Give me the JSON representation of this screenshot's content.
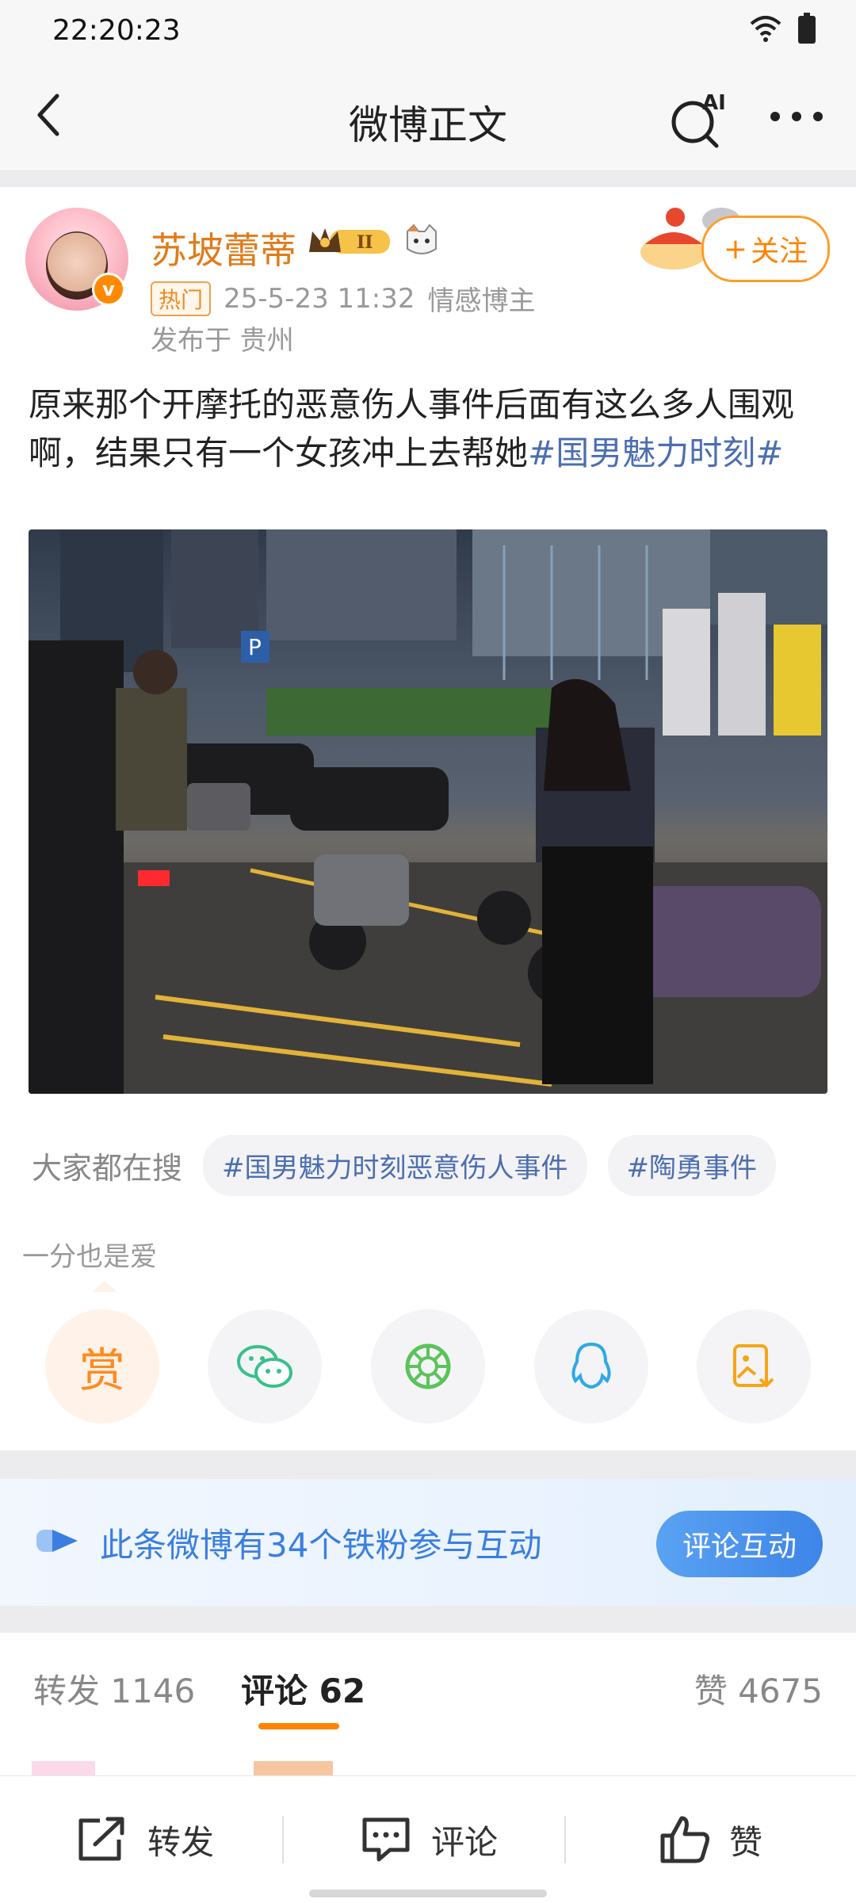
{
  "status": {
    "time": "22:20:23"
  },
  "nav": {
    "title": "微博正文",
    "ai_label": "AI"
  },
  "post": {
    "author": "苏坡蕾蒂",
    "hot_badge": "热门",
    "time": "25-5-23 11:32",
    "tag": "情感博主",
    "location": "发布于 贵州",
    "follow_label": "关注",
    "text_main": "原来那个开摩托的恶意伤人事件后面有这么多人围观啊，结果只有一个女孩冲上去帮她",
    "text_hashtag": "#国男魅力时刻#",
    "search_label": "大家都在搜",
    "search_chips": [
      "#国男魅力时刻恶意伤人事件",
      "#陶勇事件"
    ],
    "love_text": "一分也是爱",
    "reward_label": "赏"
  },
  "fans_banner": {
    "text": "此条微博有34个铁粉参与互动",
    "button": "评论互动"
  },
  "tabs": {
    "repost": "转发 1146",
    "comment": "评论 62",
    "like": "赞 4675"
  },
  "bottom": {
    "repost": "转发",
    "comment": "评论",
    "like": "赞"
  }
}
